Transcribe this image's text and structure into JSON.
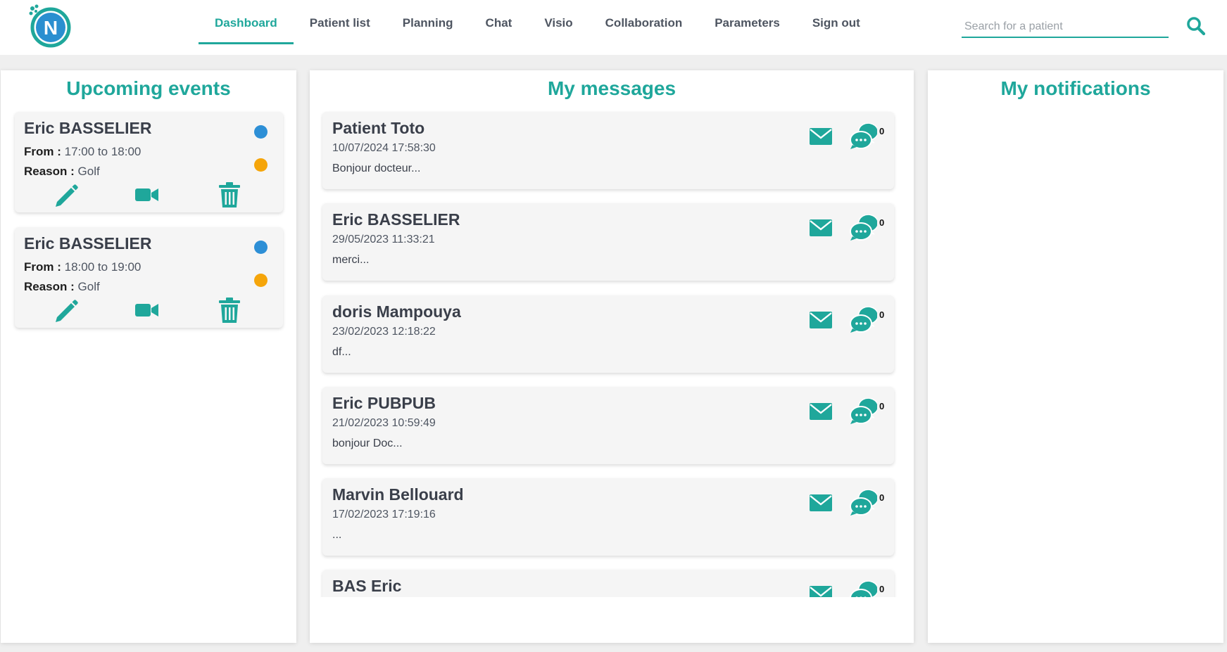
{
  "header": {
    "nav": [
      {
        "label": "Dashboard",
        "active": true
      },
      {
        "label": "Patient list"
      },
      {
        "label": "Planning"
      },
      {
        "label": "Chat"
      },
      {
        "label": "Visio"
      },
      {
        "label": "Collaboration"
      },
      {
        "label": "Parameters"
      },
      {
        "label": "Sign out"
      }
    ],
    "search_placeholder": "Search for a patient",
    "logo_letter": "N"
  },
  "colors": {
    "accent": "#1fa79b",
    "status_blue": "#2d8fd6",
    "status_orange": "#f5a50a"
  },
  "events": {
    "title": "Upcoming events",
    "from_label": "From :",
    "to_word": "to",
    "reason_label": "Reason :",
    "items": [
      {
        "name": "Eric BASSELIER",
        "from": "17:00",
        "to": "18:00",
        "reason": "Golf"
      },
      {
        "name": "Eric BASSELIER",
        "from": "18:00",
        "to": "19:00",
        "reason": "Golf"
      }
    ],
    "actions": [
      "pencil-icon",
      "video-camera-icon",
      "trash-icon"
    ]
  },
  "messages": {
    "title": "My messages",
    "items": [
      {
        "name": "Patient Toto",
        "date": "10/07/2024 17:58:30",
        "preview": "Bonjour docteur...",
        "count": "0"
      },
      {
        "name": "Eric BASSELIER",
        "date": "29/05/2023 11:33:21",
        "preview": "merci...",
        "count": "0"
      },
      {
        "name": "doris Mampouya",
        "date": "23/02/2023 12:18:22",
        "preview": "df...",
        "count": "0"
      },
      {
        "name": "Eric PUBPUB",
        "date": "21/02/2023 10:59:49",
        "preview": "bonjour Doc...",
        "count": "0"
      },
      {
        "name": "Marvin Bellouard",
        "date": "17/02/2023 17:19:16",
        "preview": "...",
        "count": "0"
      },
      {
        "name": "BAS Eric",
        "date": "",
        "preview": "",
        "count": "0"
      }
    ]
  },
  "notifications": {
    "title": "My notifications"
  }
}
